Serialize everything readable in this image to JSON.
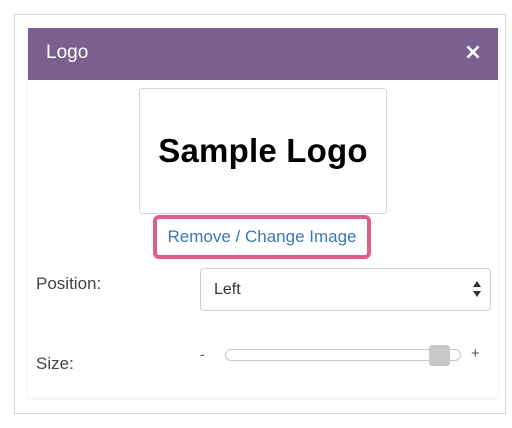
{
  "dialog": {
    "title": "Logo",
    "close_glyph": "×",
    "header_color": "#7b5f8f"
  },
  "logo": {
    "sample_text": "Sample Logo"
  },
  "actions": {
    "change_image_label": "Remove / Change Image",
    "highlight_color": "#e05f86",
    "link_color": "#3b78b3"
  },
  "position": {
    "label": "Position:",
    "selected": "Left"
  },
  "size": {
    "label": "Size:",
    "minus": "-",
    "plus": "+",
    "value_fraction": 0.95
  },
  "icons": {
    "close": "close-icon",
    "select": "up-down-arrows-icon"
  }
}
